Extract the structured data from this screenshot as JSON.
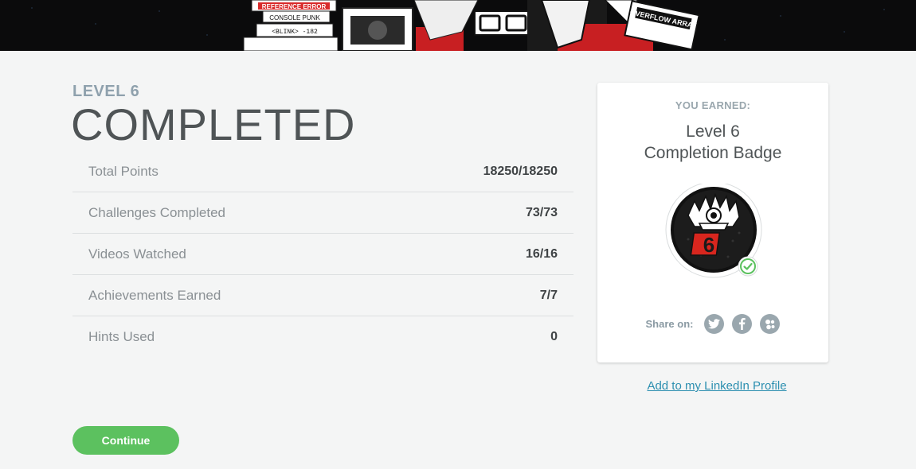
{
  "hero": {
    "stickers": [
      "REFERENCE ERROR",
      "CONSOLE PUNK",
      "<BLINK> -182",
      "OVERFLOW ARRAY"
    ]
  },
  "level": {
    "label": "LEVEL 6",
    "status": "COMPLETED"
  },
  "stats": [
    {
      "label": "Total Points",
      "value": "18250/18250"
    },
    {
      "label": "Challenges Completed",
      "value": "73/73"
    },
    {
      "label": "Videos Watched",
      "value": "16/16"
    },
    {
      "label": "Achievements Earned",
      "value": "7/7"
    },
    {
      "label": "Hints Used",
      "value": "0"
    }
  ],
  "badge": {
    "earned_label": "YOU EARNED:",
    "name_line1": "Level 6",
    "name_line2": "Completion Badge",
    "badge_digit": "6",
    "badge_icon": "punk-skull-badge-icon",
    "check_icon": "check-circle-icon"
  },
  "share": {
    "label": "Share on:",
    "networks": [
      "twitter-icon",
      "facebook-icon",
      "google-plus-icon"
    ]
  },
  "linkedin": {
    "label": "Add to my LinkedIn Profile"
  },
  "continue_button": {
    "label": "Continue"
  },
  "colors": {
    "accent_green": "#5cc15f",
    "link_blue": "#2c8fb0",
    "title_gray": "#4f5456",
    "label_blue_gray": "#8fa1ad"
  }
}
